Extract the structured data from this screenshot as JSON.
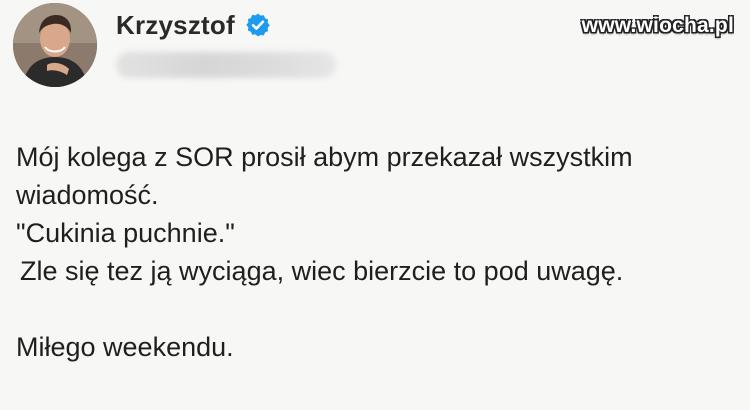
{
  "author": {
    "display_name": "Krzysztof",
    "verified": true,
    "handle_blurred": true
  },
  "watermark": "www.wiocha.pl",
  "tweet": {
    "lines": [
      "Mój kolega z SOR prosił abym przekazał wszystkim",
      "wiadomość.",
      "\"Cukinia puchnie.\"",
      "Zle się tez ją wyciąga, wiec bierzcie to pod uwagę.",
      "Miłego weekendu."
    ]
  },
  "colors": {
    "background": "#f7f7f5",
    "text": "#1f1f1f",
    "verified_badge": "#1d9bf0"
  },
  "icons": {
    "verified": "verified-badge-icon"
  }
}
